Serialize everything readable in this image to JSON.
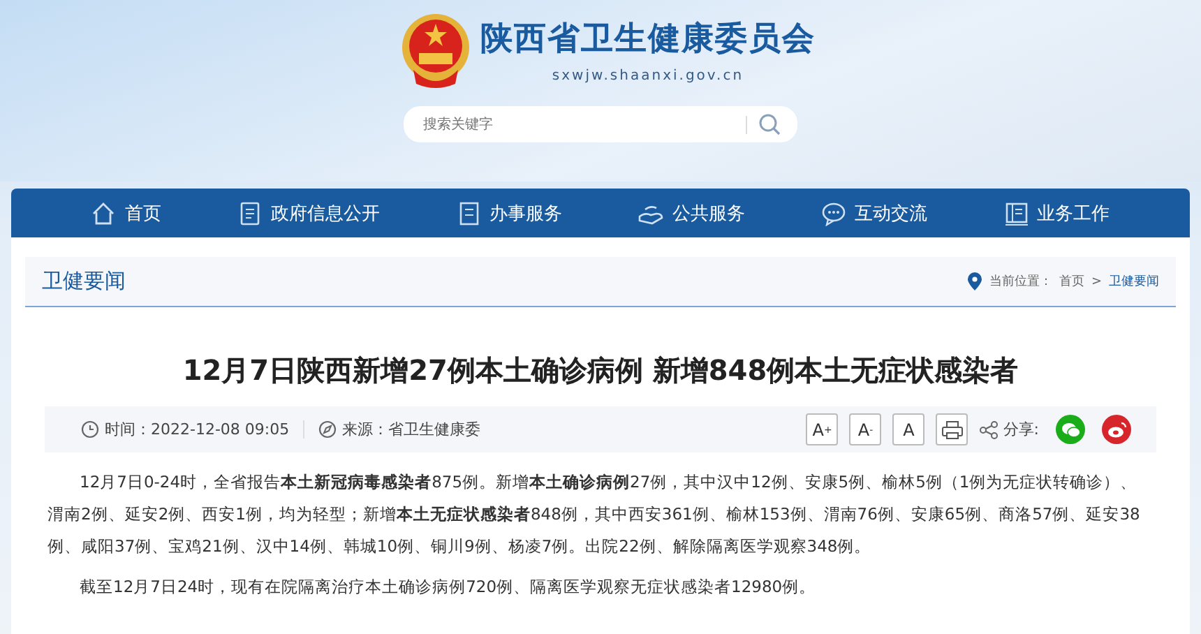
{
  "header": {
    "site_title": "陕西省卫生健康委员会",
    "domain": "sxwjw.shaanxi.gov.cn",
    "search": {
      "placeholder": "搜索关键字"
    }
  },
  "nav": [
    {
      "label": "首页"
    },
    {
      "label": "政府信息公开"
    },
    {
      "label": "办事服务"
    },
    {
      "label": "公共服务"
    },
    {
      "label": "互动交流"
    },
    {
      "label": "业务工作"
    }
  ],
  "section": {
    "title": "卫健要闻",
    "location_label": "当前位置：",
    "breadcrumb": [
      "首页",
      "卫健要闻"
    ],
    "separator": ">"
  },
  "article": {
    "title": "12月7日陕西新增27例本土确诊病例 新增848例本土无症状感染者",
    "time": "时间：2022-12-08 09:05",
    "source": "来源：省卫生健康委",
    "font_buttons": [
      "A$^{+}$",
      "A$^{-}$",
      "A"
    ],
    "share_label": "分享:",
    "paragraphs": [
      "12月7日0-24时，全省报告**本土新冠病毒感染者**875例。新增**本土确诊病例**27例，其中汉中12例、安康5例、榆林5例（1例为无症状转确诊）、渭南2例、延安2例、西安1例，均为轻型；新增**本土无症状感染者**848例，其中西安361例、榆林153例、渭南76例、安康65例、商洛57例、延安38例、咸阳37例、宝鸡21例、汉中14例、韩城10例、铜川9例、杨凌7例。出院22例、解除隔离医学观察348例。",
      "截至12月7日24时，现有在院隔离治疗本土确诊病例720例、隔离医学观察无症状感染者12980例。"
    ]
  }
}
